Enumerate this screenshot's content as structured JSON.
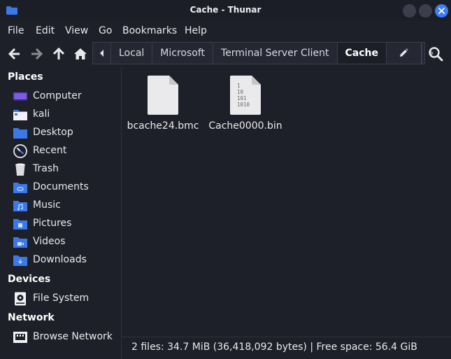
{
  "window": {
    "title": "Cache - Thunar"
  },
  "menu": [
    "File",
    "Edit",
    "View",
    "Go",
    "Bookmarks",
    "Help"
  ],
  "pathbar": {
    "crumbs": [
      "Local",
      "Microsoft",
      "Terminal Server Client",
      "Cache"
    ]
  },
  "sidebar": {
    "places_title": "Places",
    "places": [
      "Computer",
      "kali",
      "Desktop",
      "Recent",
      "Trash",
      "Documents",
      "Music",
      "Pictures",
      "Videos",
      "Downloads"
    ],
    "devices_title": "Devices",
    "devices": [
      "File System"
    ],
    "network_title": "Network",
    "network": [
      "Browse Network"
    ]
  },
  "files": [
    {
      "name": "bcache24.bmc",
      "icon": "generic-file-icon"
    },
    {
      "name": "Cache0000.bin",
      "icon": "binary-file-icon",
      "icon_text": [
        "1",
        "10",
        "101",
        "1010"
      ]
    }
  ],
  "status": {
    "text": "2 files: 34.7 MiB (36,418,092 bytes)  |  Free space: 56.4 GiB"
  },
  "colors": {
    "accent": "#3d7df5",
    "background": "#1e2029",
    "folder": "#3b78e8"
  }
}
